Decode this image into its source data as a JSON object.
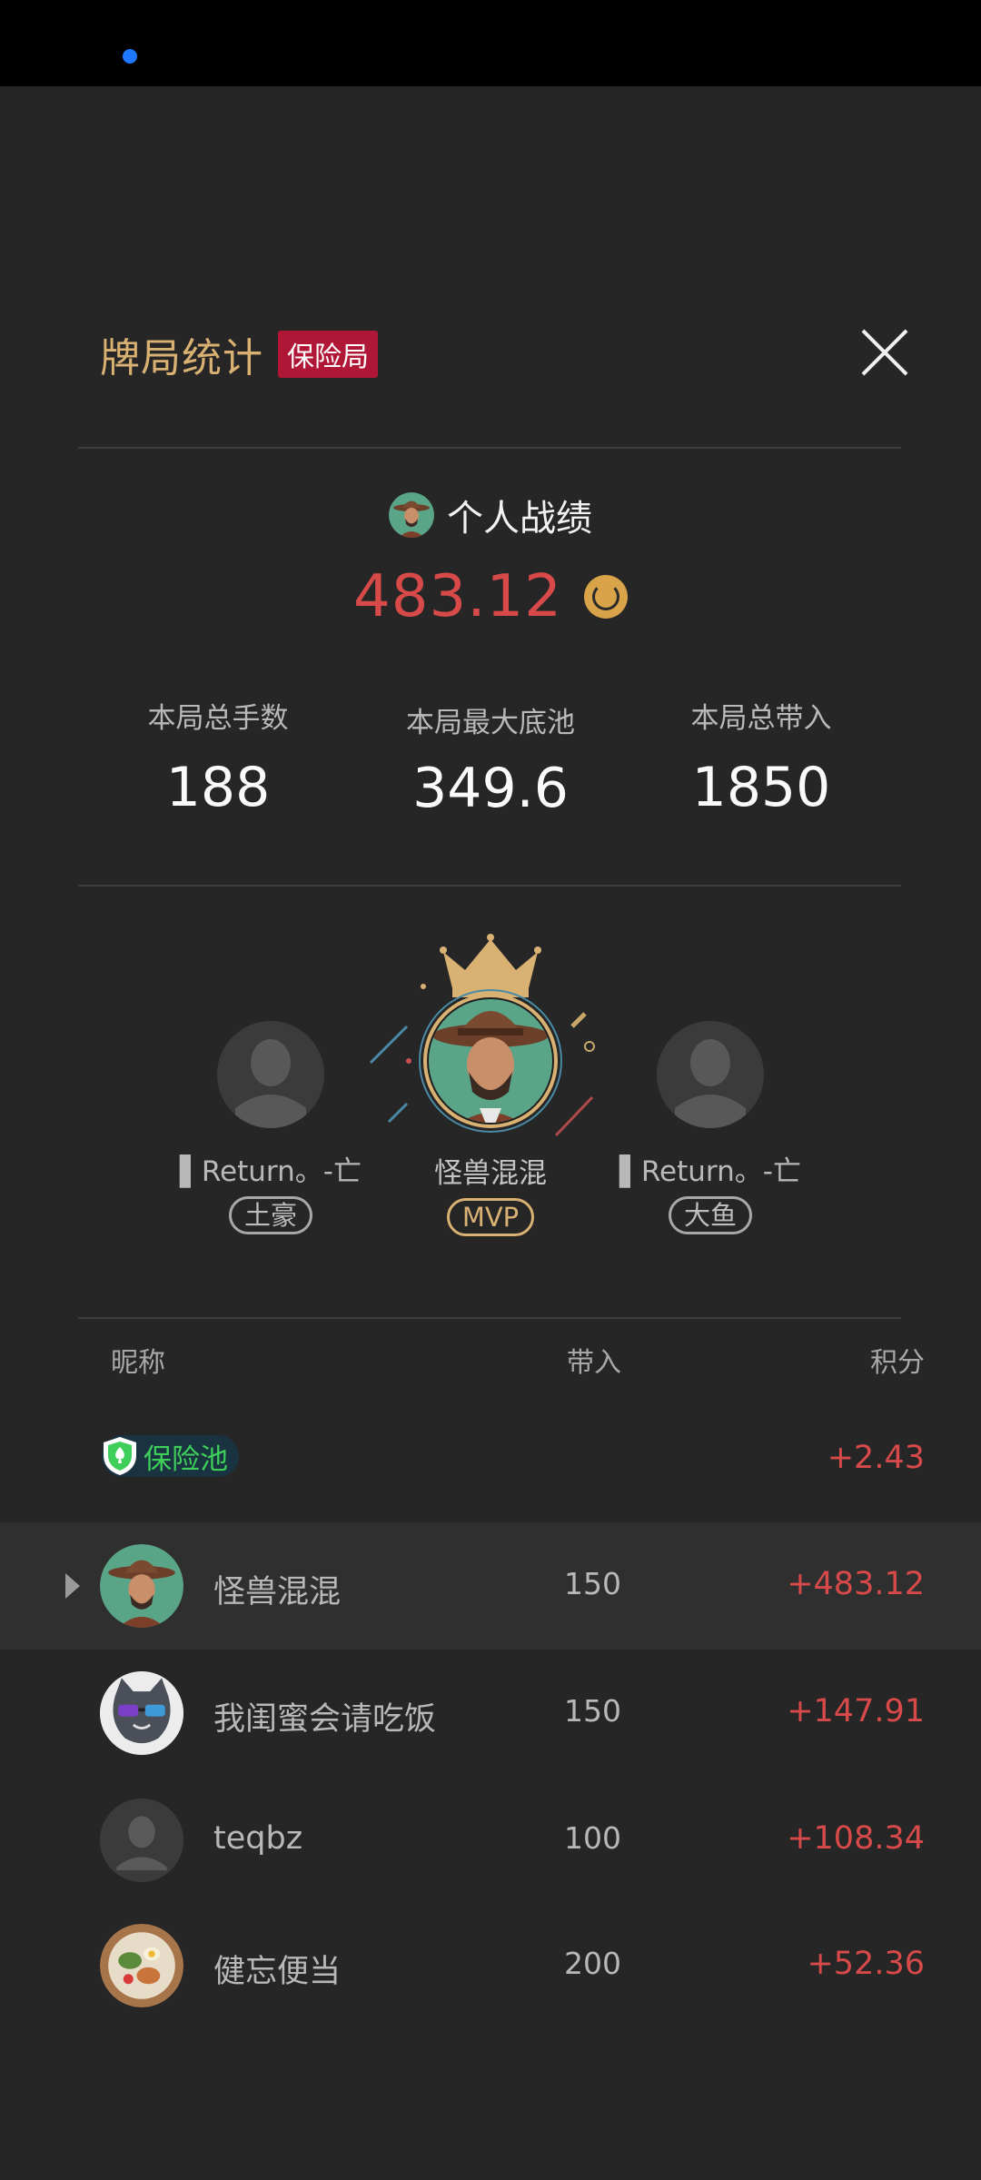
{
  "header": {
    "title": "牌局统计",
    "badge": "保险局"
  },
  "personal": {
    "label": "个人战绩",
    "score": "483.12"
  },
  "stats": [
    {
      "label": "本局总手数",
      "value": "188"
    },
    {
      "label": "本局最大底池",
      "value": "349.6"
    },
    {
      "label": "本局总带入",
      "value": "1850"
    }
  ],
  "podium": {
    "left": {
      "name": "▌Return。-亡",
      "tag": "土豪"
    },
    "center": {
      "name": "怪兽混混",
      "tag": "MVP"
    },
    "right": {
      "name": "▌Return。-亡",
      "tag": "大鱼"
    }
  },
  "table": {
    "columns": {
      "nickname": "昵称",
      "buyin": "带入",
      "score": "积分"
    },
    "pool": {
      "label": "保险池",
      "score": "+2.43"
    },
    "rows": [
      {
        "name": "怪兽混混",
        "buyin": "150",
        "score": "+483.12",
        "avatar": "cowboy-avatar",
        "highlighted": true
      },
      {
        "name": "我闺蜜会请吃饭",
        "buyin": "150",
        "score": "+147.91",
        "avatar": "cat-sunglasses-avatar",
        "highlighted": false
      },
      {
        "name": "teqbz",
        "buyin": "100",
        "score": "+108.34",
        "avatar": "default-person-avatar",
        "highlighted": false
      },
      {
        "name": "健忘便当",
        "buyin": "200",
        "score": "+52.36",
        "avatar": "food-plate-avatar",
        "highlighted": false
      }
    ]
  },
  "colors": {
    "accent_gold": "#d9b172",
    "badge_red": "#b01636",
    "score_red": "#d84a4a",
    "pool_green": "#3ecf5a"
  }
}
